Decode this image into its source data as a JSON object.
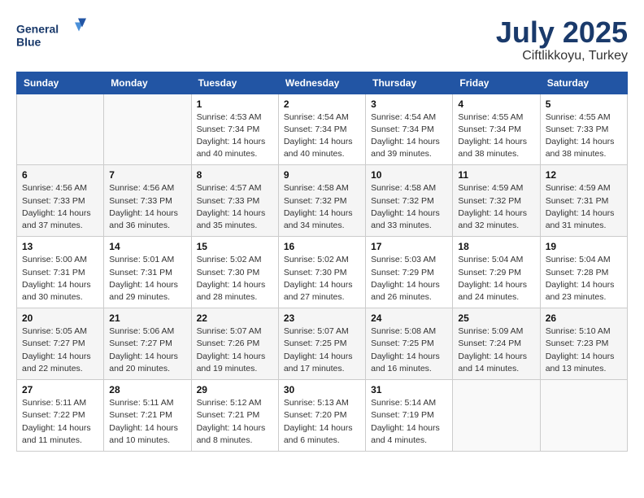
{
  "header": {
    "logo_line1": "General",
    "logo_line2": "Blue",
    "month_year": "July 2025",
    "location": "Ciftlikkoyu, Turkey"
  },
  "weekdays": [
    "Sunday",
    "Monday",
    "Tuesday",
    "Wednesday",
    "Thursday",
    "Friday",
    "Saturday"
  ],
  "weeks": [
    [
      {
        "day": "",
        "sunrise": "",
        "sunset": "",
        "daylight": ""
      },
      {
        "day": "",
        "sunrise": "",
        "sunset": "",
        "daylight": ""
      },
      {
        "day": "1",
        "sunrise": "Sunrise: 4:53 AM",
        "sunset": "Sunset: 7:34 PM",
        "daylight": "Daylight: 14 hours and 40 minutes."
      },
      {
        "day": "2",
        "sunrise": "Sunrise: 4:54 AM",
        "sunset": "Sunset: 7:34 PM",
        "daylight": "Daylight: 14 hours and 40 minutes."
      },
      {
        "day": "3",
        "sunrise": "Sunrise: 4:54 AM",
        "sunset": "Sunset: 7:34 PM",
        "daylight": "Daylight: 14 hours and 39 minutes."
      },
      {
        "day": "4",
        "sunrise": "Sunrise: 4:55 AM",
        "sunset": "Sunset: 7:34 PM",
        "daylight": "Daylight: 14 hours and 38 minutes."
      },
      {
        "day": "5",
        "sunrise": "Sunrise: 4:55 AM",
        "sunset": "Sunset: 7:33 PM",
        "daylight": "Daylight: 14 hours and 38 minutes."
      }
    ],
    [
      {
        "day": "6",
        "sunrise": "Sunrise: 4:56 AM",
        "sunset": "Sunset: 7:33 PM",
        "daylight": "Daylight: 14 hours and 37 minutes."
      },
      {
        "day": "7",
        "sunrise": "Sunrise: 4:56 AM",
        "sunset": "Sunset: 7:33 PM",
        "daylight": "Daylight: 14 hours and 36 minutes."
      },
      {
        "day": "8",
        "sunrise": "Sunrise: 4:57 AM",
        "sunset": "Sunset: 7:33 PM",
        "daylight": "Daylight: 14 hours and 35 minutes."
      },
      {
        "day": "9",
        "sunrise": "Sunrise: 4:58 AM",
        "sunset": "Sunset: 7:32 PM",
        "daylight": "Daylight: 14 hours and 34 minutes."
      },
      {
        "day": "10",
        "sunrise": "Sunrise: 4:58 AM",
        "sunset": "Sunset: 7:32 PM",
        "daylight": "Daylight: 14 hours and 33 minutes."
      },
      {
        "day": "11",
        "sunrise": "Sunrise: 4:59 AM",
        "sunset": "Sunset: 7:32 PM",
        "daylight": "Daylight: 14 hours and 32 minutes."
      },
      {
        "day": "12",
        "sunrise": "Sunrise: 4:59 AM",
        "sunset": "Sunset: 7:31 PM",
        "daylight": "Daylight: 14 hours and 31 minutes."
      }
    ],
    [
      {
        "day": "13",
        "sunrise": "Sunrise: 5:00 AM",
        "sunset": "Sunset: 7:31 PM",
        "daylight": "Daylight: 14 hours and 30 minutes."
      },
      {
        "day": "14",
        "sunrise": "Sunrise: 5:01 AM",
        "sunset": "Sunset: 7:31 PM",
        "daylight": "Daylight: 14 hours and 29 minutes."
      },
      {
        "day": "15",
        "sunrise": "Sunrise: 5:02 AM",
        "sunset": "Sunset: 7:30 PM",
        "daylight": "Daylight: 14 hours and 28 minutes."
      },
      {
        "day": "16",
        "sunrise": "Sunrise: 5:02 AM",
        "sunset": "Sunset: 7:30 PM",
        "daylight": "Daylight: 14 hours and 27 minutes."
      },
      {
        "day": "17",
        "sunrise": "Sunrise: 5:03 AM",
        "sunset": "Sunset: 7:29 PM",
        "daylight": "Daylight: 14 hours and 26 minutes."
      },
      {
        "day": "18",
        "sunrise": "Sunrise: 5:04 AM",
        "sunset": "Sunset: 7:29 PM",
        "daylight": "Daylight: 14 hours and 24 minutes."
      },
      {
        "day": "19",
        "sunrise": "Sunrise: 5:04 AM",
        "sunset": "Sunset: 7:28 PM",
        "daylight": "Daylight: 14 hours and 23 minutes."
      }
    ],
    [
      {
        "day": "20",
        "sunrise": "Sunrise: 5:05 AM",
        "sunset": "Sunset: 7:27 PM",
        "daylight": "Daylight: 14 hours and 22 minutes."
      },
      {
        "day": "21",
        "sunrise": "Sunrise: 5:06 AM",
        "sunset": "Sunset: 7:27 PM",
        "daylight": "Daylight: 14 hours and 20 minutes."
      },
      {
        "day": "22",
        "sunrise": "Sunrise: 5:07 AM",
        "sunset": "Sunset: 7:26 PM",
        "daylight": "Daylight: 14 hours and 19 minutes."
      },
      {
        "day": "23",
        "sunrise": "Sunrise: 5:07 AM",
        "sunset": "Sunset: 7:25 PM",
        "daylight": "Daylight: 14 hours and 17 minutes."
      },
      {
        "day": "24",
        "sunrise": "Sunrise: 5:08 AM",
        "sunset": "Sunset: 7:25 PM",
        "daylight": "Daylight: 14 hours and 16 minutes."
      },
      {
        "day": "25",
        "sunrise": "Sunrise: 5:09 AM",
        "sunset": "Sunset: 7:24 PM",
        "daylight": "Daylight: 14 hours and 14 minutes."
      },
      {
        "day": "26",
        "sunrise": "Sunrise: 5:10 AM",
        "sunset": "Sunset: 7:23 PM",
        "daylight": "Daylight: 14 hours and 13 minutes."
      }
    ],
    [
      {
        "day": "27",
        "sunrise": "Sunrise: 5:11 AM",
        "sunset": "Sunset: 7:22 PM",
        "daylight": "Daylight: 14 hours and 11 minutes."
      },
      {
        "day": "28",
        "sunrise": "Sunrise: 5:11 AM",
        "sunset": "Sunset: 7:21 PM",
        "daylight": "Daylight: 14 hours and 10 minutes."
      },
      {
        "day": "29",
        "sunrise": "Sunrise: 5:12 AM",
        "sunset": "Sunset: 7:21 PM",
        "daylight": "Daylight: 14 hours and 8 minutes."
      },
      {
        "day": "30",
        "sunrise": "Sunrise: 5:13 AM",
        "sunset": "Sunset: 7:20 PM",
        "daylight": "Daylight: 14 hours and 6 minutes."
      },
      {
        "day": "31",
        "sunrise": "Sunrise: 5:14 AM",
        "sunset": "Sunset: 7:19 PM",
        "daylight": "Daylight: 14 hours and 4 minutes."
      },
      {
        "day": "",
        "sunrise": "",
        "sunset": "",
        "daylight": ""
      },
      {
        "day": "",
        "sunrise": "",
        "sunset": "",
        "daylight": ""
      }
    ]
  ]
}
